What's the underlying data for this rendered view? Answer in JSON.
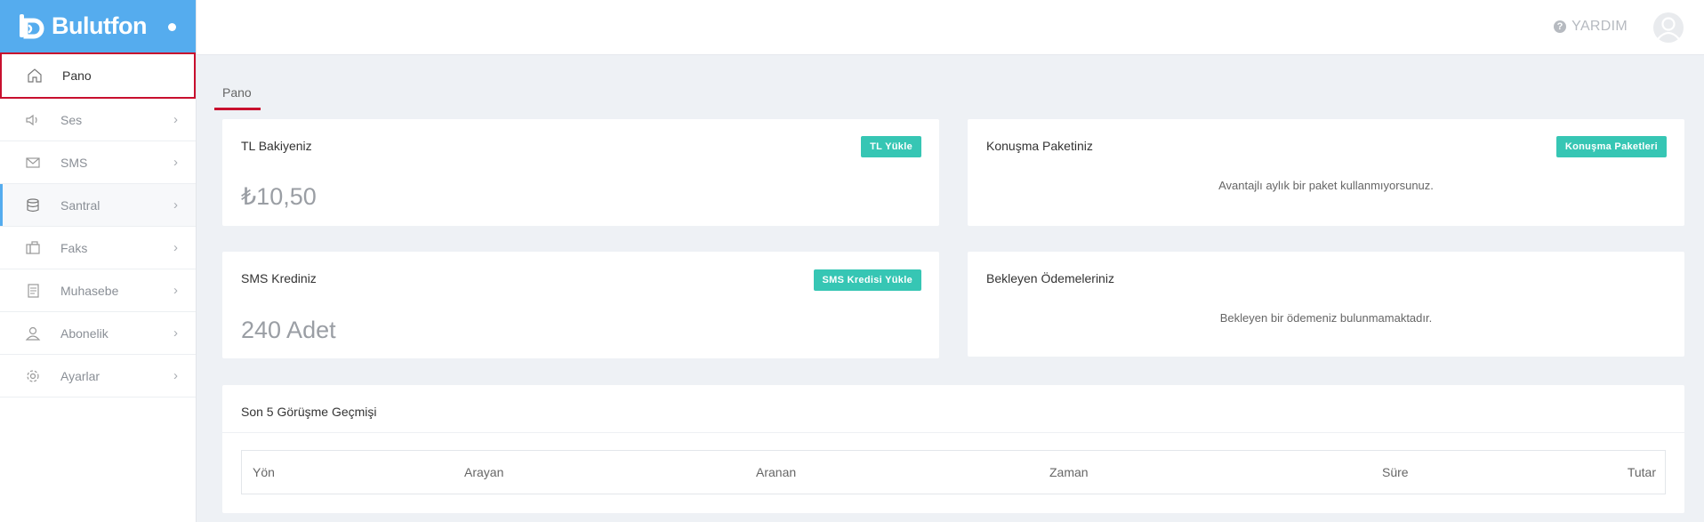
{
  "brand": {
    "name": "Bulutfon"
  },
  "sidebar": {
    "items": [
      {
        "label": "Pano",
        "icon": "home-icon",
        "chevron": ""
      },
      {
        "label": "Ses",
        "icon": "speaker-icon",
        "chevron": "›"
      },
      {
        "label": "SMS",
        "icon": "envelope-icon",
        "chevron": "›"
      },
      {
        "label": "Santral",
        "icon": "database-icon",
        "chevron": "›"
      },
      {
        "label": "Faks",
        "icon": "fax-icon",
        "chevron": "›"
      },
      {
        "label": "Muhasebe",
        "icon": "document-icon",
        "chevron": "›"
      },
      {
        "label": "Abonelik",
        "icon": "user-icon",
        "chevron": "›"
      },
      {
        "label": "Ayarlar",
        "icon": "gear-icon",
        "chevron": "›"
      }
    ]
  },
  "topbar": {
    "help_label": "YARDIM",
    "help_icon": "question-icon",
    "avatar_icon": "avatar-icon"
  },
  "breadcrumb": {
    "current": "Pano"
  },
  "cards": {
    "balance": {
      "title": "TL Bakiyeniz",
      "button": "TL Yükle",
      "value": "₺10,50"
    },
    "package": {
      "title": "Konuşma Paketiniz",
      "button": "Konuşma Paketleri",
      "message": "Avantajlı aylık bir paket kullanmıyorsunuz."
    },
    "sms": {
      "title": "SMS Krediniz",
      "button": "SMS Kredisi Yükle",
      "value": "240 Adet"
    },
    "payments": {
      "title": "Bekleyen Ödemeleriniz",
      "message": "Bekleyen bir ödemeniz bulunmamaktadır."
    },
    "history": {
      "title": "Son 5 Görüşme Geçmişi",
      "columns": [
        "Yön",
        "Arayan",
        "Aranan",
        "Zaman",
        "Süre",
        "Tutar"
      ]
    }
  },
  "colors": {
    "brand": "#55acee",
    "accent": "#36c6b4",
    "highlight_border": "#c8102e"
  }
}
